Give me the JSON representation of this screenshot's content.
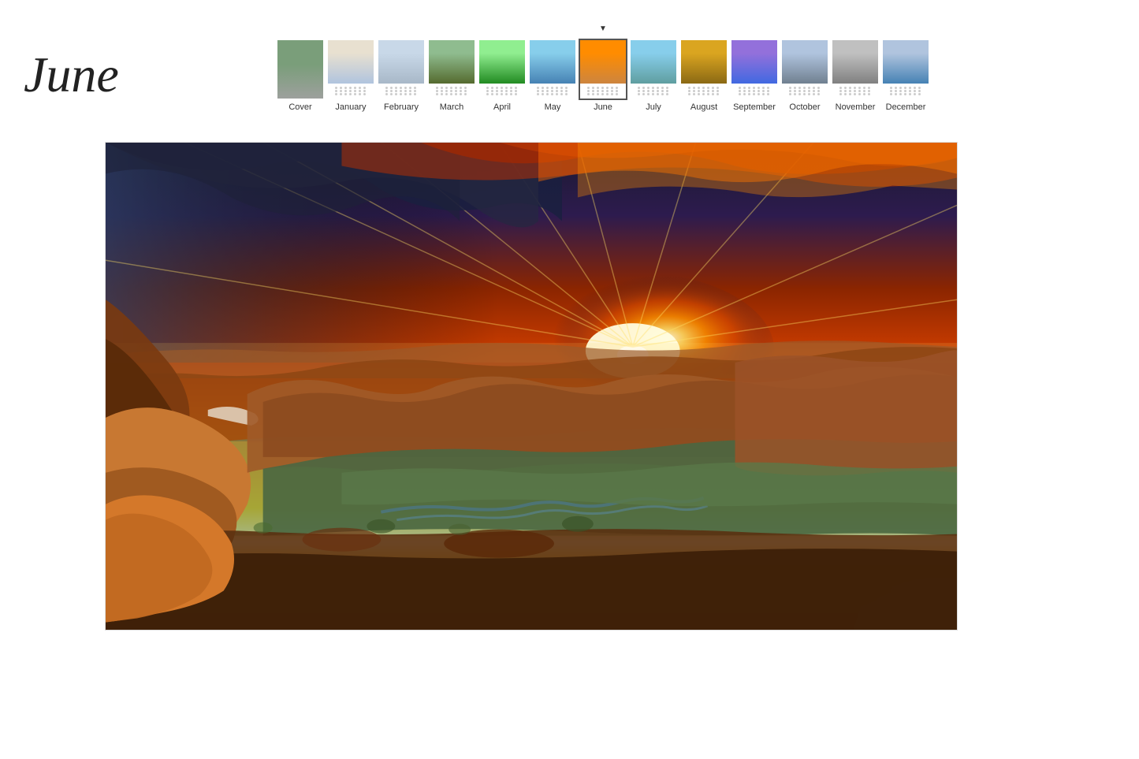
{
  "header": {
    "month_title": "June"
  },
  "thumbnail_strip": {
    "active_index": 6,
    "items": [
      {
        "label": "Cover",
        "color_class": "color-cover",
        "is_cover": true
      },
      {
        "label": "January",
        "color_class": "color-jan",
        "is_cover": false
      },
      {
        "label": "February",
        "color_class": "color-feb",
        "is_cover": false
      },
      {
        "label": "March",
        "color_class": "color-mar",
        "is_cover": false
      },
      {
        "label": "April",
        "color_class": "color-apr",
        "is_cover": false
      },
      {
        "label": "May",
        "color_class": "color-may",
        "is_cover": false
      },
      {
        "label": "June",
        "color_class": "color-jun",
        "is_cover": false
      },
      {
        "label": "July",
        "color_class": "color-jul",
        "is_cover": false
      },
      {
        "label": "August",
        "color_class": "color-aug",
        "is_cover": false
      },
      {
        "label": "September",
        "color_class": "color-sep",
        "is_cover": false
      },
      {
        "label": "October",
        "color_class": "color-oct",
        "is_cover": false
      },
      {
        "label": "November",
        "color_class": "color-nov",
        "is_cover": false
      },
      {
        "label": "December",
        "color_class": "color-dec",
        "is_cover": false
      }
    ]
  },
  "main_image": {
    "alt": "Grand Canyon sunset panorama with dramatic orange and red sky"
  }
}
